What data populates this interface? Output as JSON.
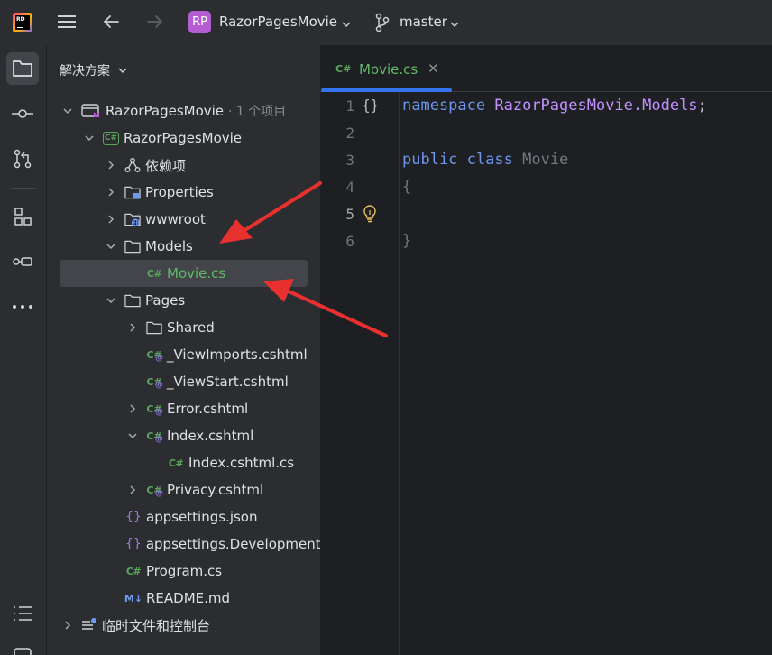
{
  "titlebar": {
    "app_logo_text": "RD",
    "project_badge": "RP",
    "project_name": "RazorPagesMovie",
    "branch_name": "master"
  },
  "toolstrip": {
    "icons": [
      "folder-icon",
      "commit-icon",
      "pull-request-icon",
      "structure-icon",
      "services-icon",
      "more-icon",
      "todo-list-icon",
      "terminal-icon"
    ]
  },
  "panel": {
    "title": "解决方案",
    "tree": [
      {
        "label": "RazorPagesMovie",
        "suffix": "· 1 个项目",
        "icon": "solution-icon",
        "expanded": true
      },
      {
        "label": "RazorPagesMovie",
        "icon": "csharp-project-icon",
        "expanded": true
      },
      {
        "label": "依赖项",
        "icon": "dependencies-icon",
        "expanded": false
      },
      {
        "label": "Properties",
        "icon": "folder-icon",
        "expanded": false
      },
      {
        "label": "wwwroot",
        "icon": "web-folder-icon",
        "expanded": false
      },
      {
        "label": "Models",
        "icon": "folder-icon",
        "expanded": true
      },
      {
        "label": "Movie.cs",
        "icon": "csharp-file-icon",
        "selected": true
      },
      {
        "label": "Pages",
        "icon": "folder-icon",
        "expanded": true
      },
      {
        "label": "Shared",
        "icon": "folder-icon",
        "expanded": false
      },
      {
        "label": "_ViewImports.cshtml",
        "icon": "cshtml-file-icon"
      },
      {
        "label": "_ViewStart.cshtml",
        "icon": "cshtml-file-icon"
      },
      {
        "label": "Error.cshtml",
        "icon": "cshtml-file-icon",
        "expanded": false
      },
      {
        "label": "Index.cshtml",
        "icon": "cshtml-file-icon",
        "expanded": true
      },
      {
        "label": "Index.cshtml.cs",
        "icon": "csharp-file-icon"
      },
      {
        "label": "Privacy.cshtml",
        "icon": "cshtml-file-icon",
        "expanded": false
      },
      {
        "label": "appsettings.json",
        "icon": "json-file-icon"
      },
      {
        "label": "appsettings.Development.json",
        "icon": "json-file-icon"
      },
      {
        "label": "Program.cs",
        "icon": "csharp-file-icon"
      },
      {
        "label": "README.md",
        "icon": "markdown-file-icon"
      },
      {
        "label": "临时文件和控制台",
        "icon": "scratches-icon",
        "expanded": false
      }
    ],
    "icon_text": {
      "cs": "C#",
      "md": "M↓",
      "json": "{}"
    }
  },
  "editor": {
    "tab": {
      "label": "Movie.cs",
      "icon_text": "C#",
      "close": "✕"
    },
    "fold_marker": "{}",
    "line_numbers": [
      "1",
      "2",
      "3",
      "4",
      "5",
      "6"
    ],
    "code": {
      "l1_kw": "namespace",
      "l1_ns": "RazorPagesMovie.Models",
      "l1_semi": ";",
      "l3_kw1": "public",
      "l3_kw2": "class",
      "l3_cls": "Movie",
      "l4": "{",
      "l6": "}"
    }
  },
  "colors": {
    "annotation_arrow": "#e8302f",
    "selection": "#43454a",
    "tab_underline": "#3574f0"
  }
}
